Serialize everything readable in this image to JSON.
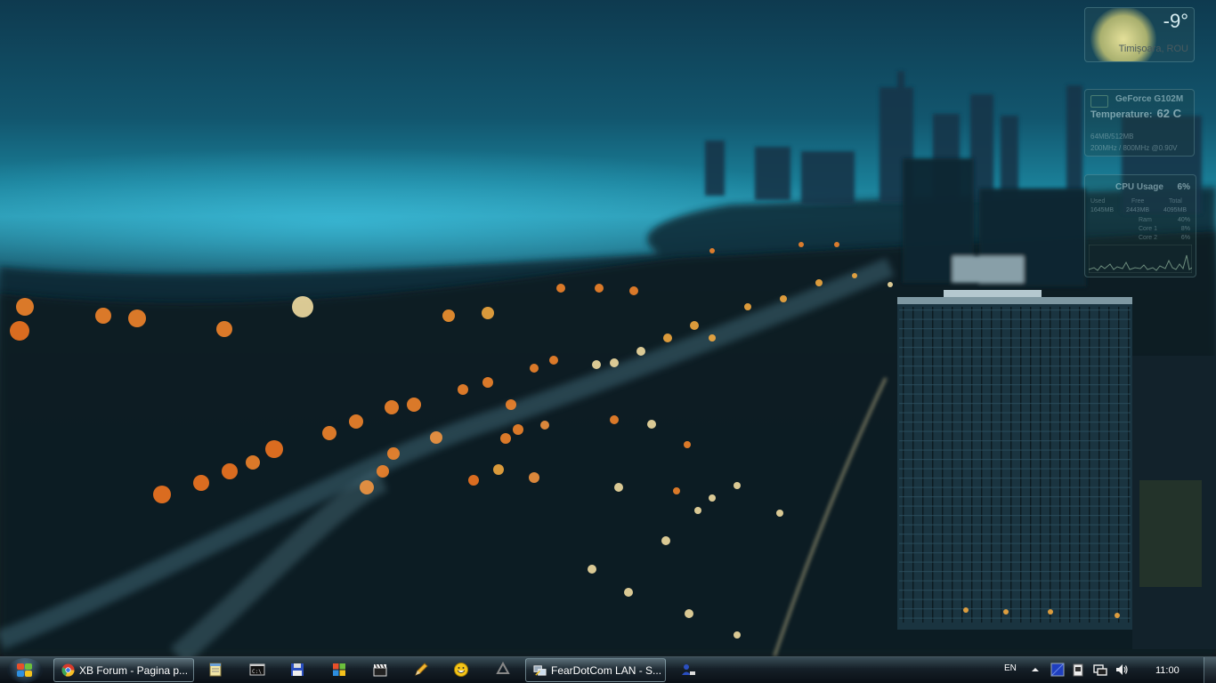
{
  "desktop": {
    "weather": {
      "temperature": "-9°",
      "location": "Timișoara, ROU",
      "icon": "sun-icon"
    },
    "gpu_meter": {
      "name": "GeForce G102M",
      "temperature_label": "Temperature:",
      "temperature_value": "62 C",
      "memory": "64MB/512MB",
      "clocks": "200MHz / 800MHz @0.90V"
    },
    "cpu_meter": {
      "title": "CPU Usage",
      "usage": "6%",
      "columns": [
        "Used",
        "Free",
        "Total"
      ],
      "memory_values": [
        "1645MB",
        "2443MB",
        "4095MB"
      ],
      "rows": [
        {
          "label": "Ram",
          "value": "40%"
        },
        {
          "label": "Core 1",
          "value": "8%"
        },
        {
          "label": "Core 2",
          "value": "6%"
        }
      ]
    }
  },
  "taskbar": {
    "start_icon": "windows-logo-icon",
    "open_windows": [
      {
        "label": "XB Forum - Pagina p...",
        "icon": "chrome-icon"
      },
      {
        "label": "FearDotCom LAN - S...",
        "icon": "network-app-icon"
      }
    ],
    "pinned_icons": [
      "notepad-icon",
      "command-prompt-icon",
      "floppy-disk-icon",
      "windows-flag-icon",
      "clapperboard-icon",
      "pencil-icon",
      "smiley-icon",
      "recycle-icon",
      "user-network-icon"
    ],
    "tray": {
      "language": "EN",
      "clock": "11:00",
      "icons": [
        "show-hidden-icons-chevron",
        "blue-square-icon",
        "document-icon",
        "network-icon",
        "volume-icon"
      ]
    }
  },
  "colors": {
    "sky_top": "#0e3a4f",
    "lake": "#2a95ad",
    "taskbar": "#16202a",
    "orange_light": "#ff8a2a"
  }
}
